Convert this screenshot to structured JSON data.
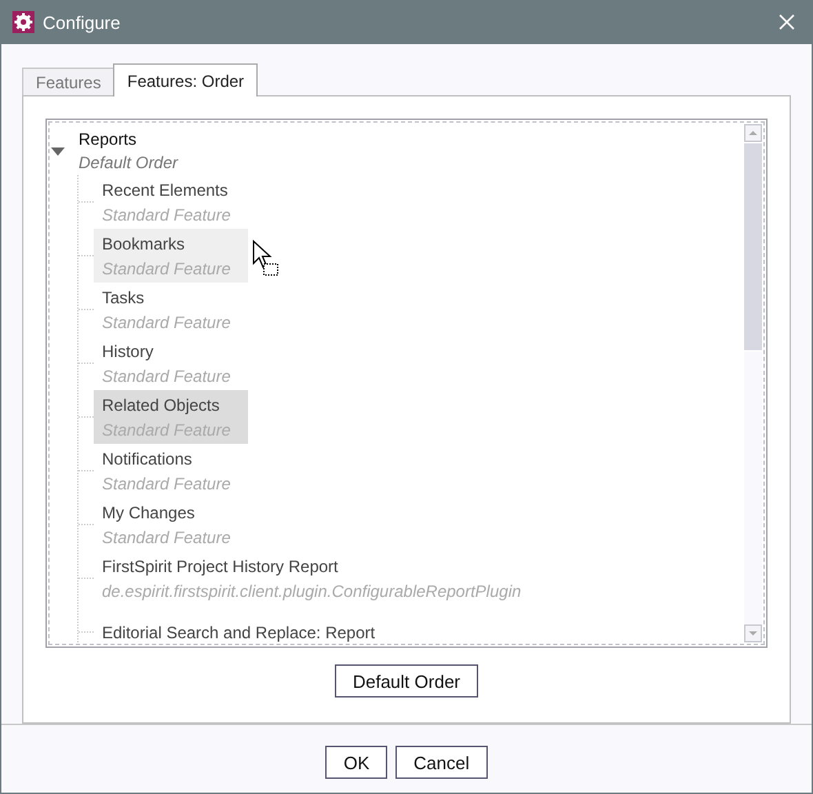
{
  "window": {
    "title": "Configure"
  },
  "tabs": [
    {
      "label": "Features",
      "selected": false
    },
    {
      "label": "Features: Order",
      "selected": true
    }
  ],
  "tree": {
    "name": "Reports",
    "description": "Default Order",
    "expanded": true,
    "children": [
      {
        "name": "Recent Elements",
        "description": "Standard Feature",
        "selected": false,
        "hovered": false
      },
      {
        "name": "Bookmarks",
        "description": "Standard Feature",
        "selected": false,
        "hovered": true
      },
      {
        "name": "Tasks",
        "description": "Standard Feature",
        "selected": false,
        "hovered": false
      },
      {
        "name": "History",
        "description": "Standard Feature",
        "selected": false,
        "hovered": false
      },
      {
        "name": "Related Objects",
        "description": "Standard Feature",
        "selected": true,
        "hovered": false
      },
      {
        "name": "Notifications",
        "description": "Standard Feature",
        "selected": false,
        "hovered": false
      },
      {
        "name": "My Changes",
        "description": "Standard Feature",
        "selected": false,
        "hovered": false
      },
      {
        "name": "FirstSpirit Project History Report",
        "description": "de.espirit.firstspirit.client.plugin.ConfigurableReportPlugin",
        "selected": false,
        "hovered": false
      },
      {
        "name": "Editorial Search and Replace: Report",
        "selected": false,
        "hovered": false
      }
    ]
  },
  "panel_button": "Default Order",
  "buttons": [
    "OK",
    "Cancel"
  ]
}
